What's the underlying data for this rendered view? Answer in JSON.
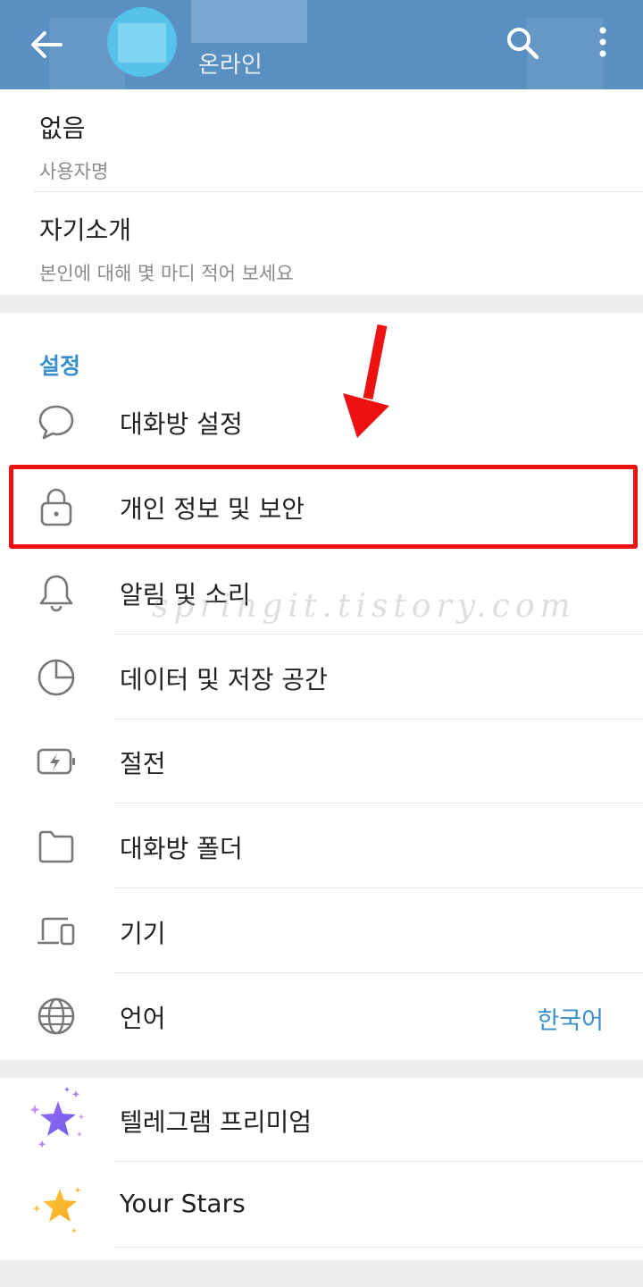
{
  "header": {
    "status": "온라인",
    "back_icon": "arrow-left-icon",
    "search_icon": "search-icon",
    "more_icon": "more-vertical-icon",
    "color": "#5a8fc1"
  },
  "profile": {
    "username_value": "없음",
    "username_label": "사용자명",
    "bio_title": "자기소개",
    "bio_placeholder": "본인에 대해 몇 마디 적어 보세요"
  },
  "settings": {
    "section_title": "설정",
    "items": [
      {
        "label": "대화방 설정",
        "icon": "chat-bubble-icon"
      },
      {
        "label": "개인 정보 및 보안",
        "icon": "lock-icon"
      },
      {
        "label": "알림 및 소리",
        "icon": "bell-icon"
      },
      {
        "label": "데이터 및 저장 공간",
        "icon": "pie-chart-icon"
      },
      {
        "label": "절전",
        "icon": "battery-icon"
      },
      {
        "label": "대화방 폴더",
        "icon": "folder-icon"
      },
      {
        "label": "기기",
        "icon": "devices-icon"
      },
      {
        "label": "언어",
        "icon": "globe-icon",
        "value": "한국어"
      }
    ]
  },
  "premium": {
    "items": [
      {
        "label": "텔레그램 프리미엄",
        "icon": "premium-star-icon"
      },
      {
        "label": "Your Stars",
        "icon": "gold-star-icon"
      }
    ]
  },
  "watermark": "springit.tistory.com",
  "accent_color": "#3a8fcf",
  "highlight_color": "#ee1111"
}
